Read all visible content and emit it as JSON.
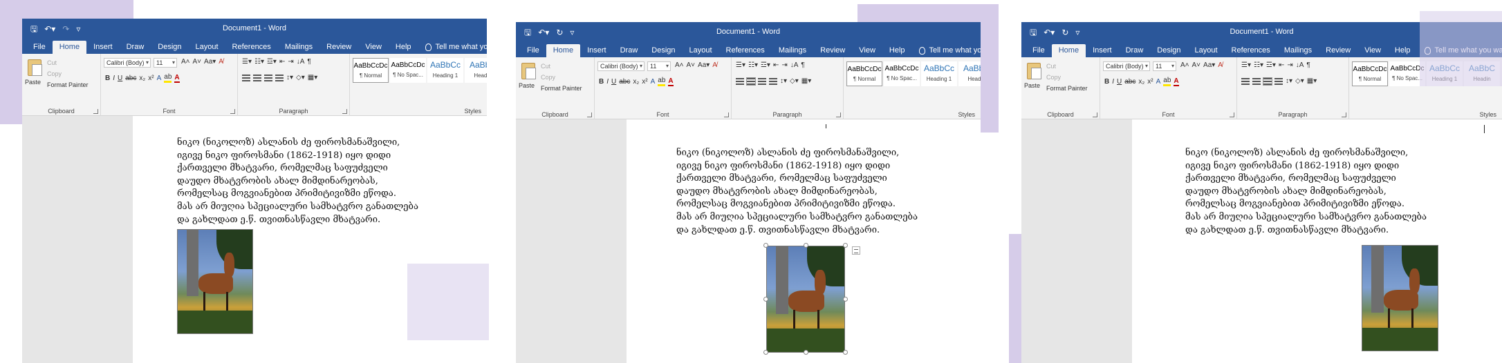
{
  "app": {
    "window_title": "Document1  -  Word",
    "tabs": [
      "File",
      "Home",
      "Insert",
      "Draw",
      "Design",
      "Layout",
      "References",
      "Mailings",
      "Review",
      "View",
      "Help"
    ],
    "active_tab": "Home",
    "tell_me": "Tell me what you want to do"
  },
  "ribbon": {
    "clipboard": {
      "paste": "Paste",
      "cut": "Cut",
      "copy": "Copy",
      "format_painter": "Format Painter",
      "label": "Clipboard"
    },
    "font": {
      "family": "Calibri (Body)",
      "size": "11",
      "label": "Font"
    },
    "paragraph": {
      "label": "Paragraph"
    },
    "styles": {
      "normal_preview": "AaBbCcDc",
      "normal": "¶ Normal",
      "nospacing_preview": "AaBbCcDc",
      "nospacing": "¶ No Spac...",
      "heading1_preview": "AaBbCc",
      "heading1": "Heading 1",
      "heading2_preview": "AaBbC",
      "heading2": "Headin",
      "label": "Styles"
    }
  },
  "document": {
    "paragraph_lines": "ნიკო (ნიკოლოზ) ასლანის ძე ფიროსმანაშვილი,\nიგივე ნიკო ფიროსმანი (1862-1918) იყო დიდი\nქართველი მხატვარი, რომელმაც საფუძველი\nდაუდო მხატვრობის ახალ მიმდინარეობას,\nრომელსაც მოგვიანებით პრიმიტივიზმი ეწოდა.\nმას არ მიუღია სპეციალური სამხატვრო განათლება\nდა გახლდათ ე.წ. თვითნასწავლი მხატვარი."
  },
  "colors": {
    "title_bar": "#2b579a",
    "ribbon": "#f3f3f3",
    "workspace": "#e6e6e6",
    "decoration": "#d6cce9"
  }
}
